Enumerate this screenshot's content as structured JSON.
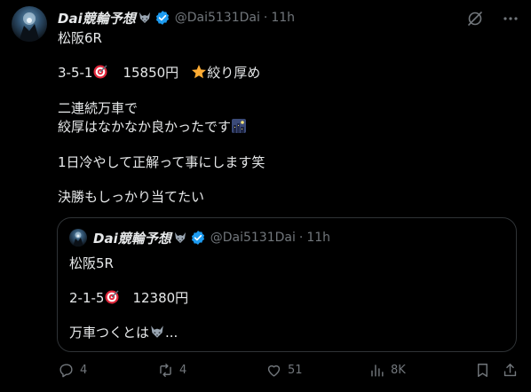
{
  "post": {
    "author_name": "Dai競輪予想",
    "handle": "@Dai5131Dai",
    "separator": "·",
    "time": "11h",
    "lines": {
      "l1": "松阪6R",
      "l2a": "3-5-1",
      "l2b": "15850円",
      "l2c": "絞り厚め",
      "l3": "二連続万車で",
      "l4": "絞厚はなかなか良かったです",
      "l5": "1日冷やして正解って事にします笑",
      "l6": "決勝もしっかり当てたい"
    }
  },
  "quote": {
    "author_name": "Dai競輪予想",
    "handle": "@Dai5131Dai",
    "separator": "·",
    "time": "11h",
    "lines": {
      "l1": "松阪5R",
      "l2a": "2-1-5",
      "l2b": "12380円",
      "l3a": "万車つくとは",
      "l3b": "..."
    }
  },
  "actions": {
    "replies": "4",
    "reposts": "4",
    "likes": "51",
    "views": "8K"
  },
  "colors": {
    "background": "#000000",
    "text": "#e7e9ea",
    "muted": "#71767b",
    "verified": "#1d9bf0",
    "border": "#2f3336"
  },
  "icons": [
    "grok-icon",
    "more-icon",
    "verified-badge-icon",
    "wolf-emoji-icon",
    "target-emoji-icon",
    "star-emoji-icon",
    "night-city-emoji-icon",
    "reply-icon",
    "repost-icon",
    "like-icon",
    "views-icon",
    "bookmark-icon",
    "share-icon"
  ]
}
